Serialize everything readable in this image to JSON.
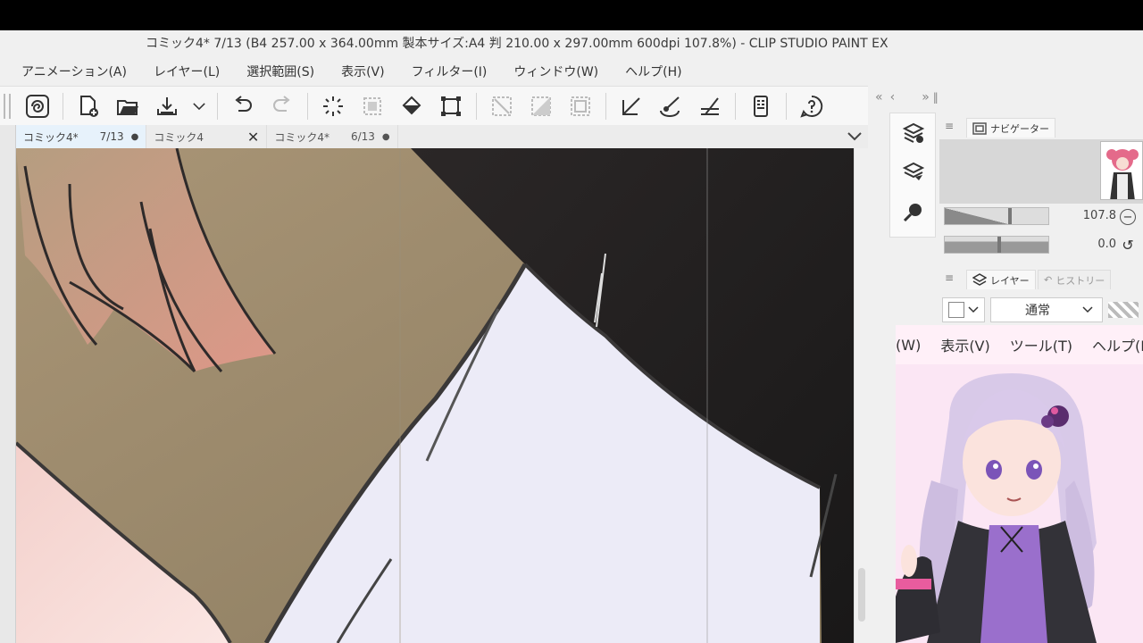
{
  "window": {
    "title": "コミック4* 7/13 (B4 257.00 x 364.00mm 製本サイズ:A4 判 210.00 x 297.00mm 600dpi 107.8%)  - CLIP STUDIO PAINT EX"
  },
  "menubar": {
    "items": [
      "アニメーション(A)",
      "レイヤー(L)",
      "選択範囲(S)",
      "表示(V)",
      "フィルター(I)",
      "ウィンドウ(W)",
      "ヘルプ(H)"
    ]
  },
  "toolbar": {
    "icons": [
      "clip-studio-logo-icon",
      "new-file-icon",
      "open-folder-icon",
      "save-icon",
      "dropdown-chevron-icon",
      "undo-icon",
      "redo-icon",
      "loading-spinner-icon",
      "transform-select-icon",
      "fill-bucket-icon",
      "scale-rotate-icon",
      "clear-selection-icon",
      "invert-selection-icon",
      "show-selection-icon",
      "ruler-snap-icon",
      "brush-snap-icon",
      "perspective-snap-icon",
      "device-icon",
      "help-icon"
    ]
  },
  "tabs": [
    {
      "name": "コミック4*",
      "page": "7/13",
      "marker": "●",
      "active": true
    },
    {
      "name": "コミック4",
      "page": "",
      "marker": "✕",
      "active": false
    },
    {
      "name": "コミック4*",
      "page": "6/13",
      "marker": "●",
      "active": false
    }
  ],
  "panel_nav": {
    "header_left": "«",
    "header_mid": "‹",
    "header_right": "»"
  },
  "navigator": {
    "tab_label": "ナビゲーター",
    "zoom_value": "107.8",
    "zoom_fraction": 0.6,
    "rotate_value": "0.0",
    "rotate_fraction": 0.5
  },
  "layer_panel": {
    "tab_layer": "レイヤー",
    "tab_history": "ヒストリー",
    "blend_mode": "通常"
  },
  "overlay_menu": {
    "items": [
      "(W)",
      "表示(V)",
      "ツール(T)",
      "ヘルプ(H)"
    ]
  },
  "colors": {
    "canvas_skin": "#8d7f63",
    "canvas_dark": "#1f1d1d",
    "shirt": "#ecebf7",
    "hair_pink": "#e89a90",
    "overlay_bg": "#fbe6f4"
  }
}
